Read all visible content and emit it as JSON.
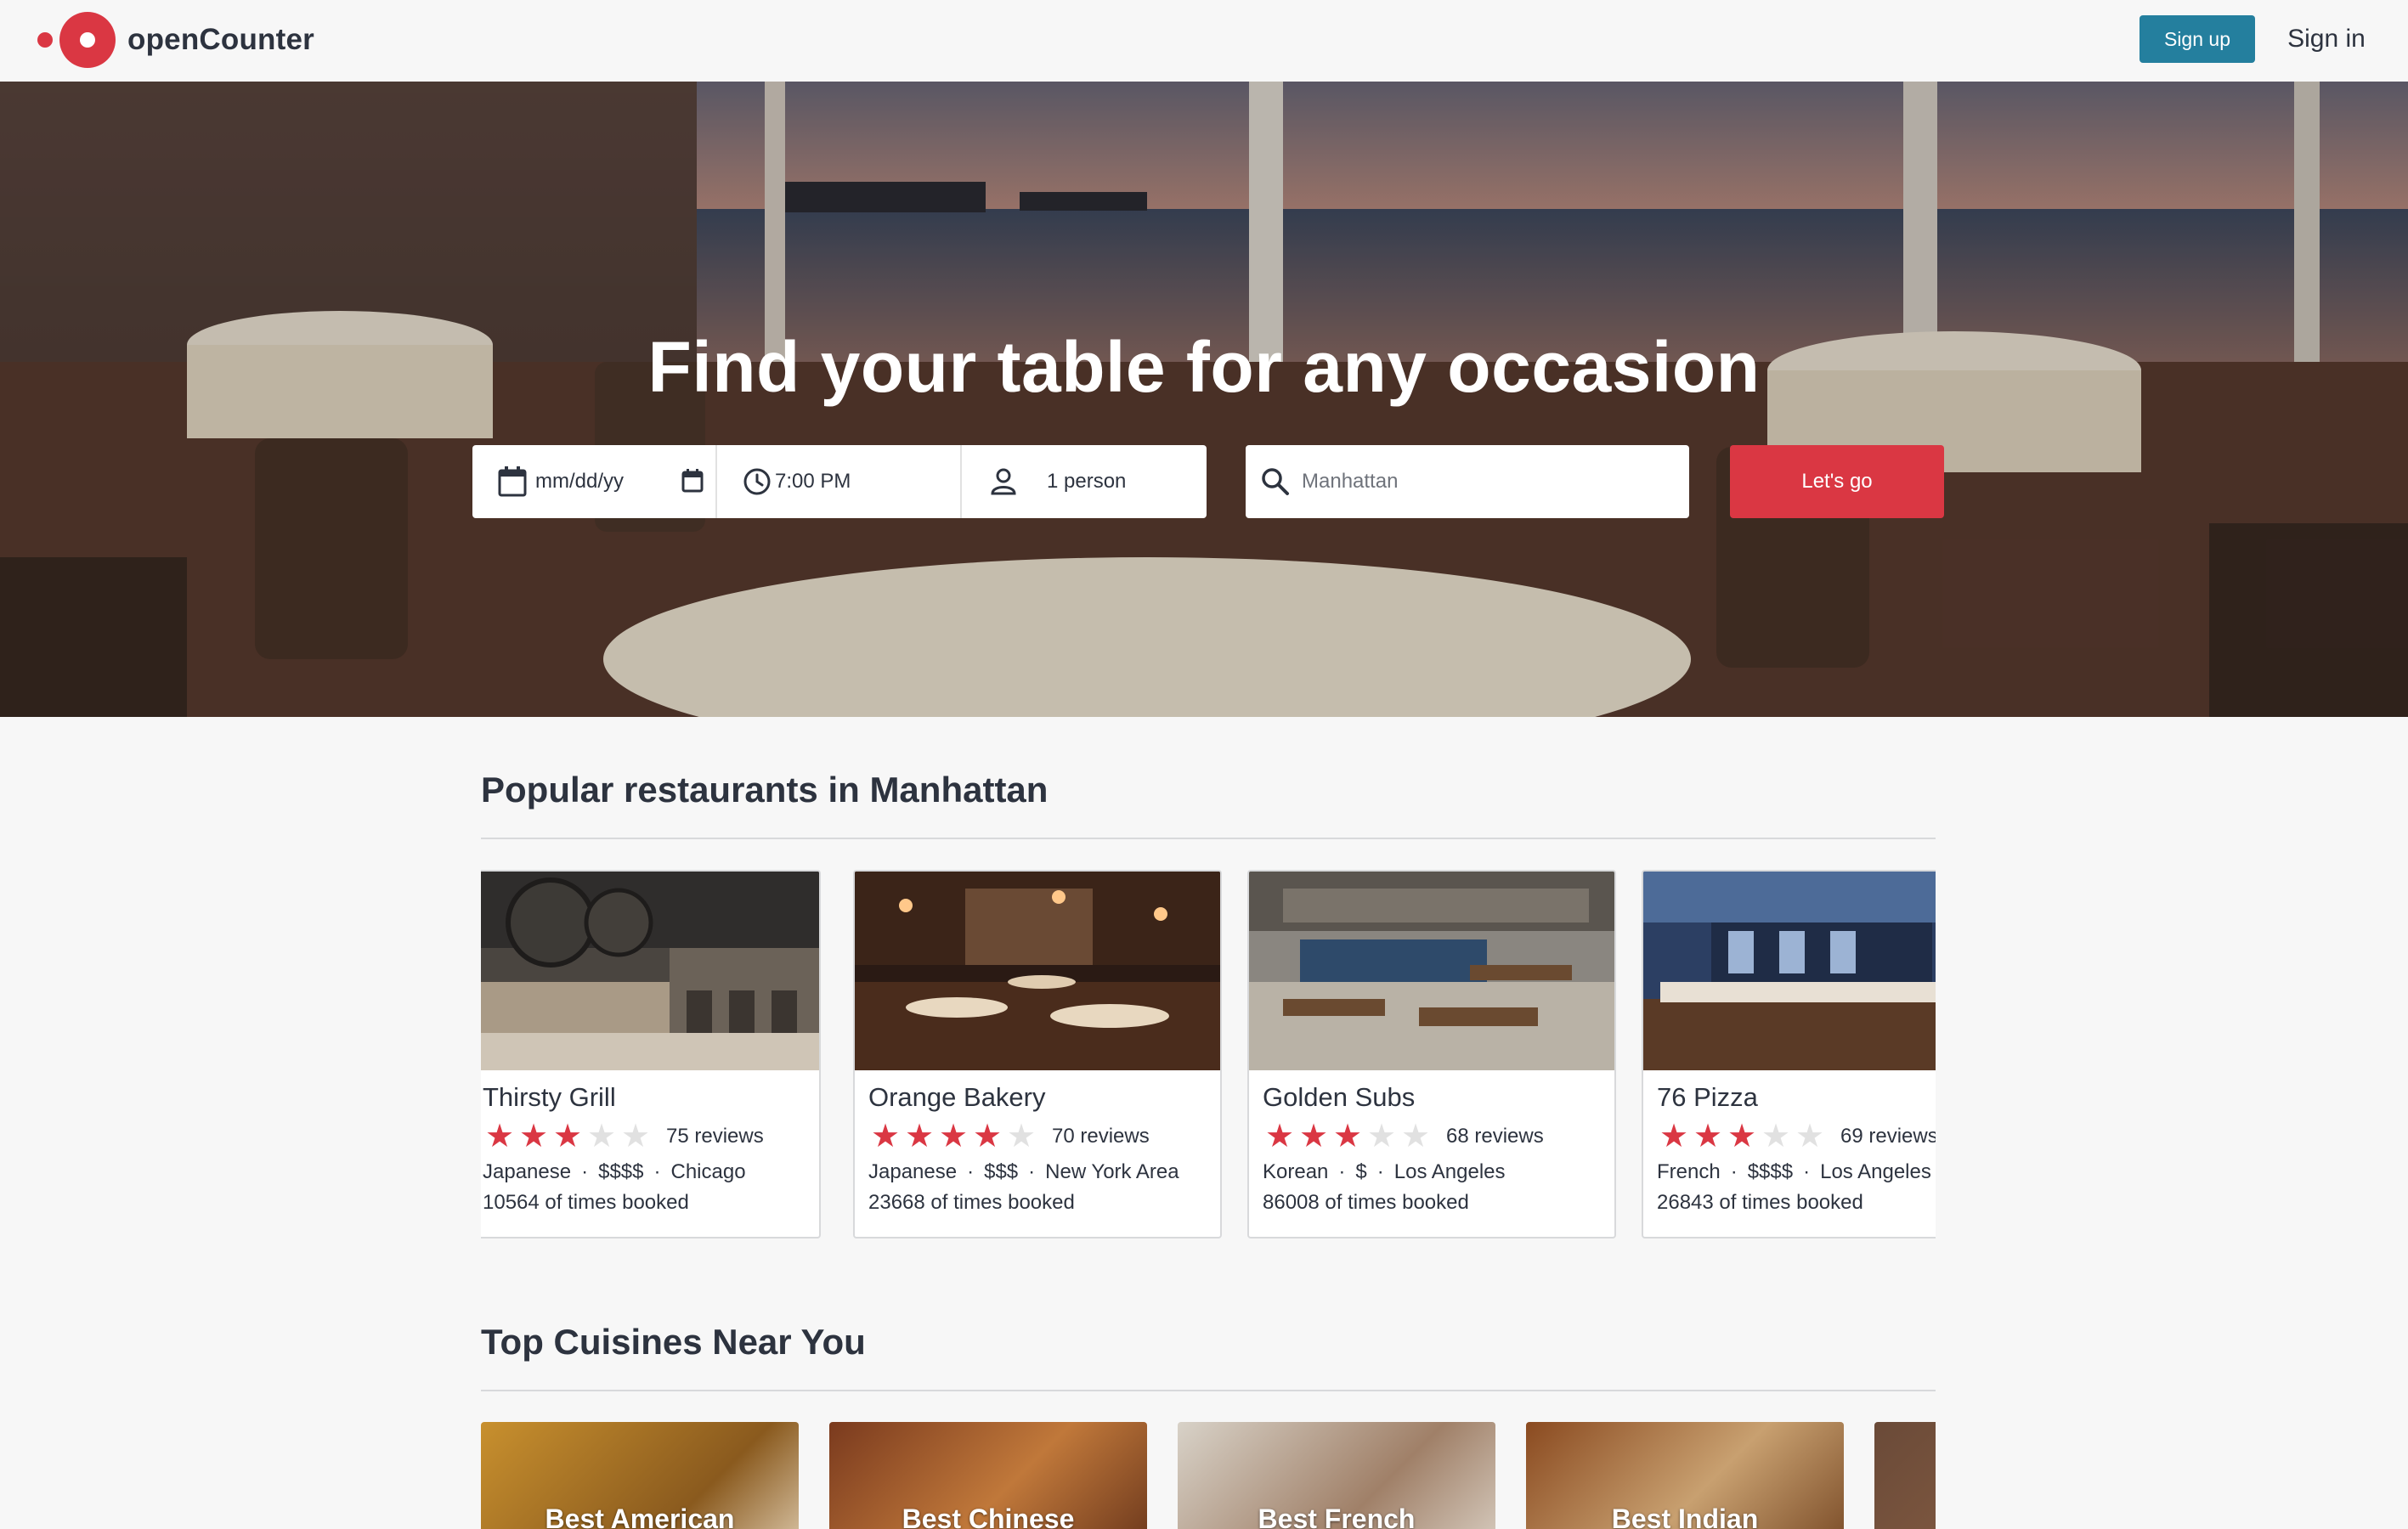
{
  "header": {
    "logo_text": "openCounter",
    "signup_label": "Sign up",
    "signin_label": "Sign in"
  },
  "hero": {
    "title": "Find your table for any occasion",
    "date_placeholder": "mm/dd/yy",
    "time_value": "7:00 PM",
    "party_value": "1 person",
    "location_placeholder": "Manhattan",
    "submit_label": "Let's go"
  },
  "popular": {
    "title": "Popular restaurants in Manhattan",
    "restaurants": [
      {
        "name": "Thirsty Grill",
        "stars": 3,
        "reviews": "75 reviews",
        "cuisine": "Japanese",
        "price": "$$$$",
        "location": "Chicago",
        "booked": "10564 of times booked"
      },
      {
        "name": "Orange Bakery",
        "stars": 4,
        "reviews": "70 reviews",
        "cuisine": "Japanese",
        "price": "$$$",
        "location": "New York Area",
        "booked": "23668 of times booked"
      },
      {
        "name": "Golden Subs",
        "stars": 3,
        "reviews": "68 reviews",
        "cuisine": "Korean",
        "price": "$",
        "location": "Los Angeles",
        "booked": "86008 of times booked"
      },
      {
        "name": "76 Pizza",
        "stars": 3,
        "reviews": "69 reviews",
        "cuisine": "French",
        "price": "$$$$",
        "location": "Los Angeles",
        "booked": "26843 of times booked"
      }
    ]
  },
  "cuisines": {
    "title": "Top Cuisines Near You",
    "items": [
      {
        "label": "Best American"
      },
      {
        "label": "Best Chinese"
      },
      {
        "label": "Best French"
      },
      {
        "label": "Best Indian"
      },
      {
        "label": ""
      }
    ]
  },
  "icons": {
    "calendar": "calendar-icon",
    "clock": "clock-icon",
    "person": "person-icon",
    "search": "search-icon",
    "star": "star-icon"
  },
  "colors": {
    "brand_red": "#da3743",
    "signup_blue": "#247f9e",
    "text": "#2d333f",
    "background": "#f7f7f7"
  }
}
